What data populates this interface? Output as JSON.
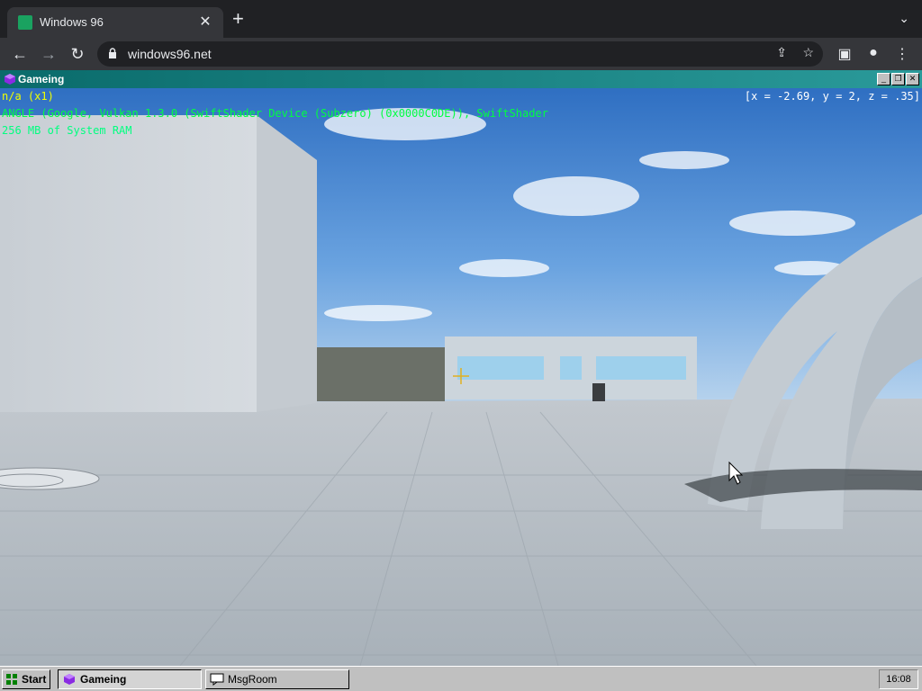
{
  "browser": {
    "tab_title": "Windows 96",
    "new_tab": "+",
    "url": "windows96.net"
  },
  "window": {
    "title": "Gameing",
    "hud": {
      "fps": "n/a (x1)",
      "renderer": "ANGLE (Google, Vulkan 1.3.0 (SwiftShader Device (Subzero) (0x0000C0DE)), SwiftShader",
      "ram": "256 MB of System RAM",
      "coords": "[x = -2.69, y = 2, z = .35]"
    }
  },
  "taskbar": {
    "start_label": "Start",
    "tasks": [
      {
        "label": "Gameing",
        "active": true
      },
      {
        "label": "MsgRoom",
        "active": false
      }
    ],
    "clock": "16:08"
  },
  "colors": {
    "title_bar": "#0a6b6b",
    "hud_fps": "#f0ff00",
    "hud_renderer": "#00ff40"
  }
}
